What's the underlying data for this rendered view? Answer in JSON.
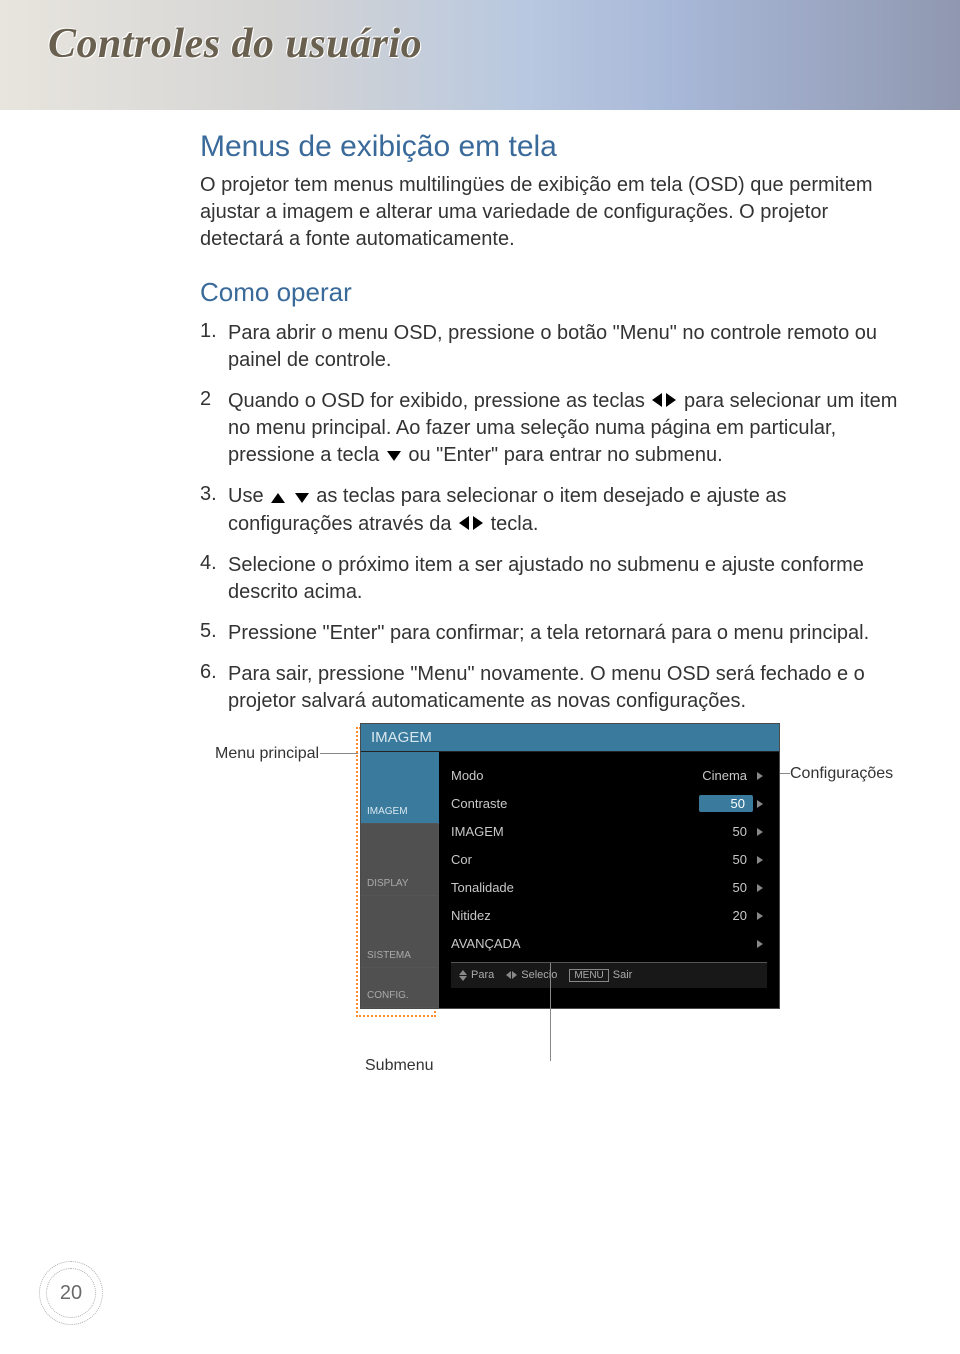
{
  "page": {
    "title": "Controles do usuário",
    "number": "20"
  },
  "section": {
    "title": "Menus de exibição em tela",
    "intro": "O projetor tem menus multilingües de exibição em tela (OSD) que permitem ajustar a imagem e alterar uma variedade de configurações. O projetor detectará a fonte automaticamente."
  },
  "howto": {
    "title": "Como operar",
    "steps": [
      {
        "num": "1.",
        "text": "Para abrir o menu OSD, pressione o botão \"Menu\" no controle remoto ou painel de controle."
      },
      {
        "num": "2",
        "segments": [
          "Quando o OSD for exibido, pressione as teclas ",
          " para selecionar um item no menu principal. Ao fazer uma seleção numa página em particular, pressione a tecla ",
          " ou \"Enter\" para entrar no submenu."
        ]
      },
      {
        "num": "3.",
        "segments": [
          "Use ",
          " as teclas para selecionar o item desejado e ajuste as configurações através da ",
          " tecla."
        ]
      },
      {
        "num": "4.",
        "text": "Selecione o próximo item a ser ajustado no submenu e ajuste conforme descrito acima."
      },
      {
        "num": "5.",
        "text": "Pressione \"Enter\" para confirmar; a tela retornará para o menu principal."
      },
      {
        "num": "6.",
        "text": "Para sair, pressione \"Menu\" novamente. O menu OSD será fechado e o projetor salvará automaticamente as novas configurações."
      }
    ]
  },
  "callouts": {
    "main_menu": "Menu principal",
    "settings": "Configurações",
    "submenu": "Submenu"
  },
  "osd": {
    "header": "IMAGEM",
    "sidebar": [
      {
        "label": "IMAGEM",
        "active": true
      },
      {
        "label": "DISPLAY",
        "active": false
      },
      {
        "label": "SISTEMA",
        "active": false
      },
      {
        "label": "CONFIG.",
        "active": false
      }
    ],
    "rows": [
      {
        "label": "Modo",
        "value": "Cinema",
        "selected": false
      },
      {
        "label": "Contraste",
        "value": "50",
        "selected": true
      },
      {
        "label": "IMAGEM",
        "value": "50",
        "selected": false
      },
      {
        "label": "Cor",
        "value": "50",
        "selected": false
      },
      {
        "label": "Tonalidade",
        "value": "50",
        "selected": false
      },
      {
        "label": "Nitidez",
        "value": "20",
        "selected": false
      },
      {
        "label": "AVANÇADA",
        "value": "",
        "selected": false
      }
    ],
    "footer": {
      "para": "Para",
      "selecio": "Selecio",
      "menu": "MENU",
      "sair": "Sair"
    }
  }
}
